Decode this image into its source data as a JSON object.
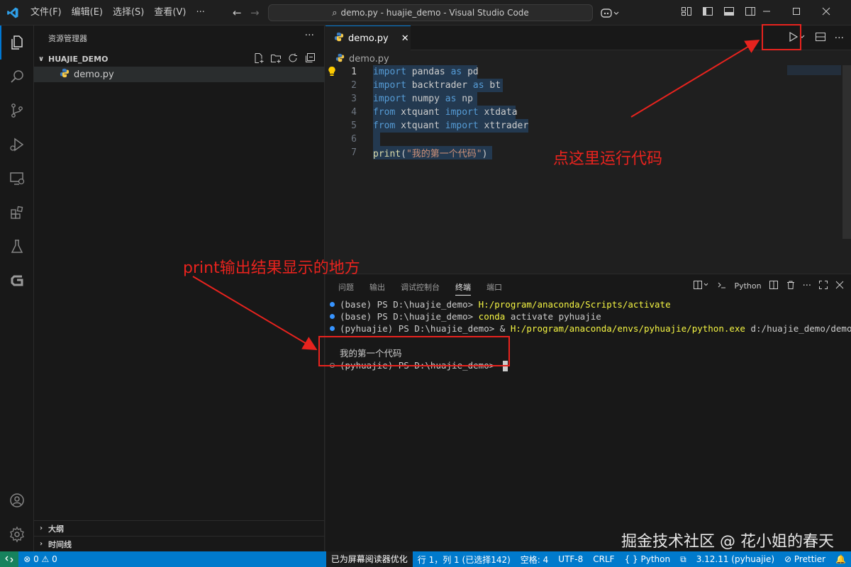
{
  "titlebar": {
    "menus": [
      "文件(F)",
      "编辑(E)",
      "选择(S)",
      "查看(V)"
    ],
    "more": "···",
    "command_center": "demo.py - huajie_demo - Visual Studio Code"
  },
  "sidebar": {
    "title": "资源管理器",
    "folder": "HUAJIE_DEMO",
    "file": "demo.py",
    "sections": [
      "大纲",
      "时间线"
    ]
  },
  "editor": {
    "tab_label": "demo.py",
    "breadcrumb": "demo.py",
    "lines": [
      {
        "n": "1",
        "tokens": [
          [
            "kw",
            "import"
          ],
          [
            "id",
            " pandas "
          ],
          [
            "kw",
            "as"
          ],
          [
            "id",
            " pd"
          ]
        ]
      },
      {
        "n": "2",
        "tokens": [
          [
            "kw",
            "import"
          ],
          [
            "id",
            " backtrader "
          ],
          [
            "kw",
            "as"
          ],
          [
            "id",
            " bt"
          ]
        ]
      },
      {
        "n": "3",
        "tokens": [
          [
            "kw",
            "import"
          ],
          [
            "id",
            " numpy "
          ],
          [
            "kw",
            "as"
          ],
          [
            "id",
            " np"
          ]
        ]
      },
      {
        "n": "4",
        "tokens": [
          [
            "kw",
            "from"
          ],
          [
            "id",
            " xtquant "
          ],
          [
            "kw",
            "import"
          ],
          [
            "id",
            " xtdata"
          ]
        ]
      },
      {
        "n": "5",
        "tokens": [
          [
            "kw",
            "from"
          ],
          [
            "id",
            " xtquant "
          ],
          [
            "kw",
            "import"
          ],
          [
            "id",
            " xttrader"
          ]
        ]
      },
      {
        "n": "6",
        "tokens": []
      },
      {
        "n": "7",
        "tokens": [
          [
            "fn",
            "print"
          ],
          [
            "id",
            "("
          ],
          [
            "str",
            "\"我的第一个代码\""
          ],
          [
            "id",
            ")"
          ]
        ]
      }
    ]
  },
  "panel": {
    "tabs": [
      "问题",
      "输出",
      "调试控制台",
      "终端",
      "端口"
    ],
    "active_tab": "终端",
    "terminal_profile": "Python",
    "terminal": {
      "line1_prompt": "(base) PS D:\\huajie_demo> ",
      "line1_cmd": "H:/program/anaconda/Scripts/activate",
      "line2_prompt": "(base) PS D:\\huajie_demo> ",
      "line2_cmd": "conda",
      "line2_rest": " activate pyhuajie",
      "line3_prompt": "(pyhuajie) PS D:\\huajie_demo> & ",
      "line3_cmd": "H:/program/anaconda/envs/pyhuajie/python.exe",
      "line3_rest": " d:/huajie_demo/demo.py",
      "output": "我的第一个代码",
      "line5_prompt": "(pyhuajie) PS D:\\huajie_demo> "
    }
  },
  "statusbar": {
    "problems": "0",
    "warnings": "0",
    "screen_reader": "已为屏幕阅读器优化",
    "cursor": "行 1，列 1 (已选择142)",
    "spaces": "空格: 4",
    "encoding": "UTF-8",
    "eol": "CRLF",
    "language": "Python",
    "interpreter": "3.12.11 (pyhuajie)",
    "prettier": "Prettier"
  },
  "annotations": {
    "run_hint": "点这里运行代码",
    "output_hint": "print输出结果显示的地方"
  },
  "watermark": "掘金技术社区 @ 花小姐的春天"
}
